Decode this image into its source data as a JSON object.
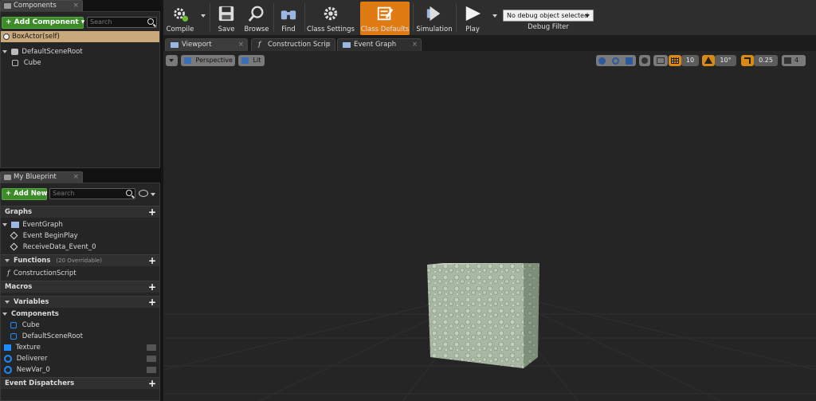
{
  "components_panel": {
    "tab_label": "Components",
    "add_button": "+ Add Component ▾",
    "search_placeholder": "Search",
    "self_item": "BoxActor(self)",
    "tree": [
      {
        "label": "DefaultSceneRoot"
      },
      {
        "label": "Cube"
      }
    ]
  },
  "blueprint_panel": {
    "tab_label": "My Blueprint",
    "add_button": "+ Add New ▾",
    "search_placeholder": "Search",
    "graphs_header": "Graphs",
    "event_graph": "EventGraph",
    "events": [
      "Event BeginPlay",
      "ReceiveData_Event_0"
    ],
    "functions_header": "Functions",
    "functions_sub": "(20 Overridable)",
    "construction_script": "ConstructionScript",
    "macros_header": "Macros",
    "variables_header": "Variables",
    "components_header": "Components",
    "component_vars": [
      "Cube",
      "DefaultSceneRoot"
    ],
    "variables": [
      "Texture",
      "Deliverer",
      "NewVar_0"
    ],
    "dispatchers_header": "Event Dispatchers"
  },
  "toolbar": {
    "compile": "Compile",
    "save": "Save",
    "browse": "Browse",
    "find": "Find",
    "class_settings": "Class Settings",
    "class_defaults": "Class Defaults",
    "simulation": "Simulation",
    "play": "Play",
    "debug_select": "No debug object selected",
    "debug_filter": "Debug Filter",
    "active_color": "#e07b13"
  },
  "doc_tabs": [
    "Viewport",
    "Construction Scrip",
    "Event Graph"
  ],
  "viewport": {
    "perspective": "Perspective",
    "lit": "Lit",
    "grid_snap": "10",
    "rot_snap": "10°",
    "scale_snap": "0.25",
    "cam_speed": "4"
  }
}
